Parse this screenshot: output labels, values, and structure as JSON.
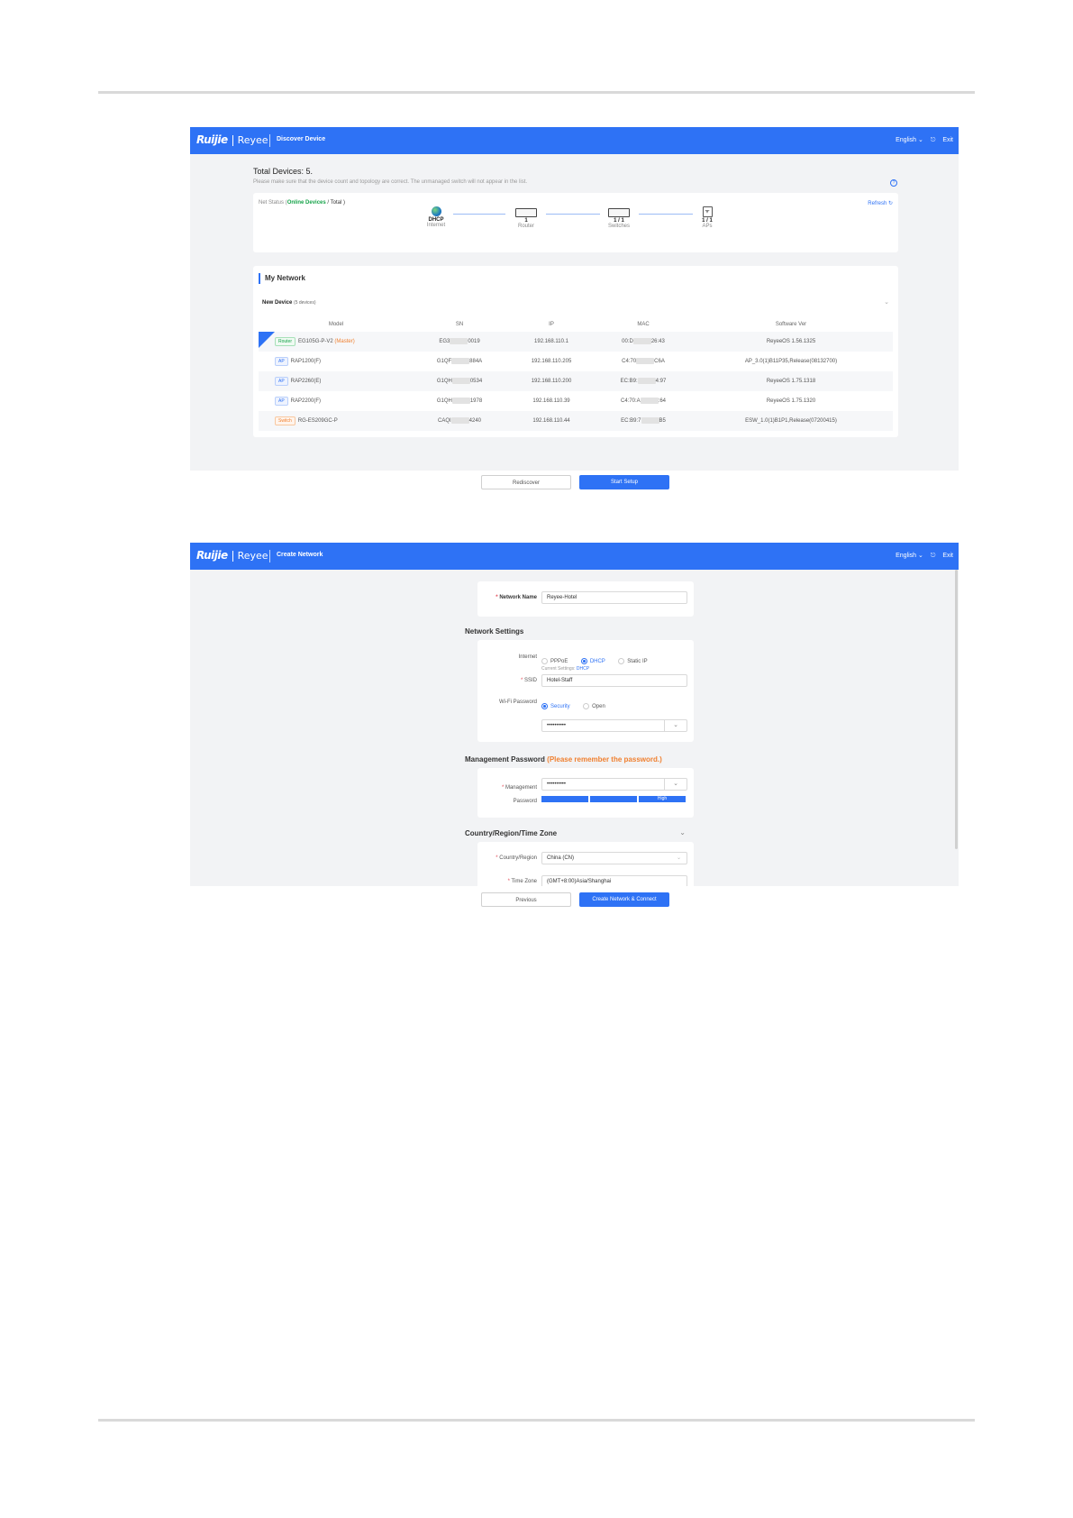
{
  "app": {
    "logo_ruijie": "Ruijie",
    "logo_reyee": "Reyee",
    "language": "English ⌄",
    "exit": "Exit"
  },
  "screen1": {
    "title": "Discover Device",
    "total_devices": "Total Devices: 5.",
    "note": "Please make sure that the device count and topology are correct. The unmanaged switch will not appear in the list.",
    "net_status_prefix": "Net Status (",
    "net_status_online": "Online Devices",
    "net_status_total": " / Total )",
    "refresh": "Refresh",
    "topology": [
      {
        "value": "DHCP",
        "label": "Internet"
      },
      {
        "value": "1",
        "label": "Router"
      },
      {
        "value": "1 / 1",
        "label": "Switches"
      },
      {
        "value": "1 / 1",
        "label": "APs"
      }
    ],
    "my_network": "My Network",
    "new_device": "New Device",
    "new_device_count": "(5 devices)",
    "columns": [
      "Model",
      "SN",
      "IP",
      "MAC",
      "Software Ver"
    ],
    "rows": [
      {
        "tag": "Router",
        "model": "EG105G-P-V2",
        "extra": "(Master)",
        "sn_a": "EG3",
        "sn_b": "0019",
        "ip": "192.168.110.1",
        "mac_a": "00:D",
        "mac_b": "26:43",
        "ver": "ReyeeOS 1.56.1325"
      },
      {
        "tag": "AP",
        "model": "RAP1200(F)",
        "extra": "",
        "sn_a": "G1QF",
        "sn_b": "884A",
        "ip": "192.168.110.205",
        "mac_a": "C4:70",
        "mac_b": "C6A",
        "ver": "AP_3.0(1)B11P35,Release(08132700)"
      },
      {
        "tag": "AP",
        "model": "RAP2260(E)",
        "extra": "",
        "sn_a": "G1QH",
        "sn_b": "0534",
        "ip": "192.168.110.200",
        "mac_a": "EC:B9:",
        "mac_b": "4:97",
        "ver": "ReyeeOS 1.75.1318"
      },
      {
        "tag": "AP",
        "model": "RAP2200(F)",
        "extra": "",
        "sn_a": "G1QH",
        "sn_b": "1978",
        "ip": "192.168.110.39",
        "mac_a": "C4:70:A",
        "mac_b": ":64",
        "ver": "ReyeeOS 1.75.1320"
      },
      {
        "tag": "Switch",
        "model": "RG-ES209GC-P",
        "extra": "",
        "sn_a": "CAQI",
        "sn_b": "4240",
        "ip": "192.168.110.44",
        "mac_a": "EC:B9:7",
        "mac_b": "B5",
        "ver": "ESW_1.0(1)B1P1,Release(07200415)"
      }
    ],
    "local_badge": "Local",
    "btn_rediscover": "Rediscover",
    "btn_start": "Start Setup"
  },
  "screen2": {
    "title": "Create Network",
    "network_name_label": "Network Name",
    "network_name_value": "Reyee-Hotel",
    "network_settings": "Network Settings",
    "internet_label": "Internet",
    "internet_options": [
      "PPPoE",
      "DHCP",
      "Static IP"
    ],
    "current_settings_label": "Current Settings:",
    "current_settings_value": "DHCP",
    "ssid_label": "SSID",
    "ssid_value": "Hotel-Staff",
    "wifi_password_label": "Wi-Fi Password",
    "wifi_options": [
      "Security",
      "Open"
    ],
    "wifi_password_value": "••••••••••",
    "mgmt_title": "Management Password",
    "mgmt_note": "(Please remember the password.)",
    "mgmt_label_1": "Management",
    "mgmt_label_2": "Password",
    "mgmt_value": "••••••••••",
    "strength": "High",
    "country_title": "Country/Region/Time Zone",
    "country_label": "Country/Region",
    "country_value": "China (CN)",
    "tz_label": "Time Zone",
    "tz_value": "(GMT+8:00)Asia/Shanghai",
    "btn_previous": "Previous",
    "btn_create": "Create Network & Connect"
  }
}
